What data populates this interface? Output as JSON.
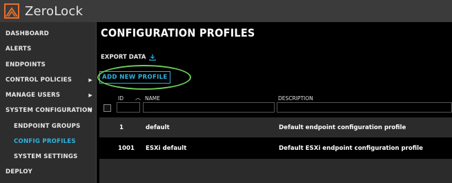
{
  "app": {
    "title": "ZeroLock",
    "brand_color": "#e8702a",
    "accent_color": "#2fb3e0",
    "highlight_color": "#6fd15a"
  },
  "sidebar": {
    "items": [
      {
        "label": "DASHBOARD"
      },
      {
        "label": "ALERTS"
      },
      {
        "label": "ENDPOINTS"
      },
      {
        "label": "CONTROL POLICIES",
        "icon": "chevron-right-icon"
      },
      {
        "label": "MANAGE USERS",
        "icon": "chevron-right-icon"
      },
      {
        "label": "SYSTEM CONFIGURATION",
        "icon": "chevron-down-icon"
      },
      {
        "label": "ENDPOINT GROUPS"
      },
      {
        "label": "CONFIG PROFILES",
        "active": true
      },
      {
        "label": "SYSTEM SETTINGS"
      },
      {
        "label": "DEPLOY"
      }
    ]
  },
  "main": {
    "title": "CONFIGURATION PROFILES",
    "export_label": "EXPORT DATA",
    "add_button_label": "ADD NEW PROFILE",
    "table": {
      "columns": [
        "ID",
        "NAME",
        "DESCRIPTION"
      ],
      "rows": [
        {
          "id": "1",
          "name": "default",
          "description": "Default endpoint configuration profile"
        },
        {
          "id": "1001",
          "name": "ESXi default",
          "description": "Default ESXi endpoint configuration profile"
        }
      ]
    }
  }
}
